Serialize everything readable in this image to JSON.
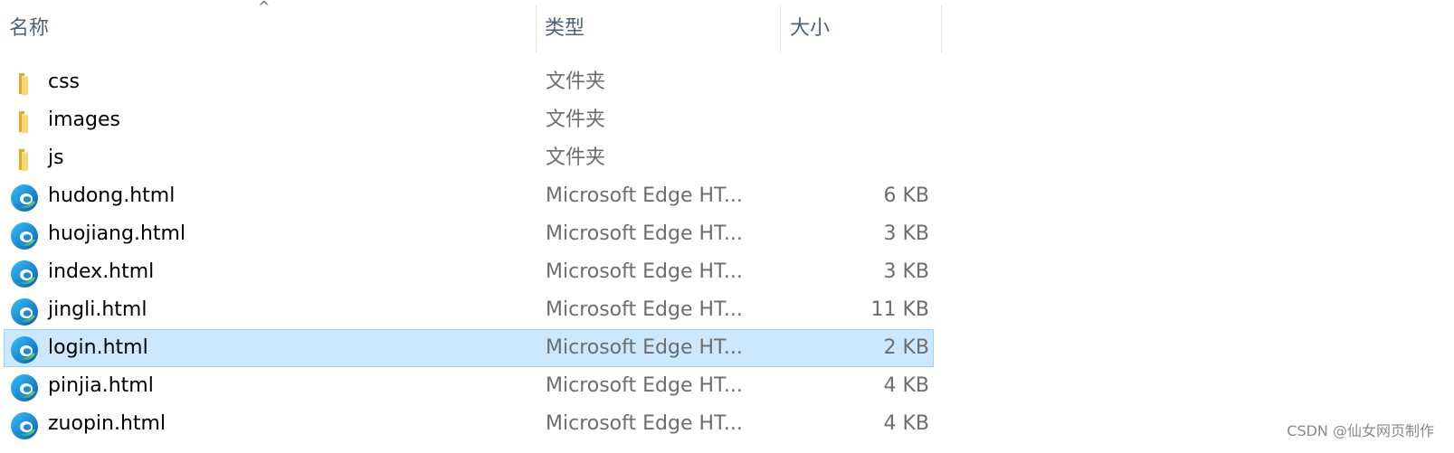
{
  "columns": {
    "name": "名称",
    "type": "类型",
    "size": "大小"
  },
  "files": [
    {
      "name": "css",
      "type": "文件夹",
      "size": "",
      "icon": "folder-icon",
      "selected": false
    },
    {
      "name": "images",
      "type": "文件夹",
      "size": "",
      "icon": "folder-icon",
      "selected": false
    },
    {
      "name": "js",
      "type": "文件夹",
      "size": "",
      "icon": "folder-icon",
      "selected": false
    },
    {
      "name": "hudong.html",
      "type": "Microsoft Edge HT...",
      "size": "6 KB",
      "icon": "edge-icon",
      "selected": false
    },
    {
      "name": "huojiang.html",
      "type": "Microsoft Edge HT...",
      "size": "3 KB",
      "icon": "edge-icon",
      "selected": false
    },
    {
      "name": "index.html",
      "type": "Microsoft Edge HT...",
      "size": "3 KB",
      "icon": "edge-icon",
      "selected": false
    },
    {
      "name": "jingli.html",
      "type": "Microsoft Edge HT...",
      "size": "11 KB",
      "icon": "edge-icon",
      "selected": false
    },
    {
      "name": "login.html",
      "type": "Microsoft Edge HT...",
      "size": "2 KB",
      "icon": "edge-icon",
      "selected": true
    },
    {
      "name": "pinjia.html",
      "type": "Microsoft Edge HT...",
      "size": "4 KB",
      "icon": "edge-icon",
      "selected": false
    },
    {
      "name": "zuopin.html",
      "type": "Microsoft Edge HT...",
      "size": "4 KB",
      "icon": "edge-icon",
      "selected": false
    }
  ],
  "watermark": "CSDN @仙女网页制作",
  "colors": {
    "selection": "#cce8ff",
    "selection_border": "#99d1ff",
    "header_text": "#4c607a"
  }
}
